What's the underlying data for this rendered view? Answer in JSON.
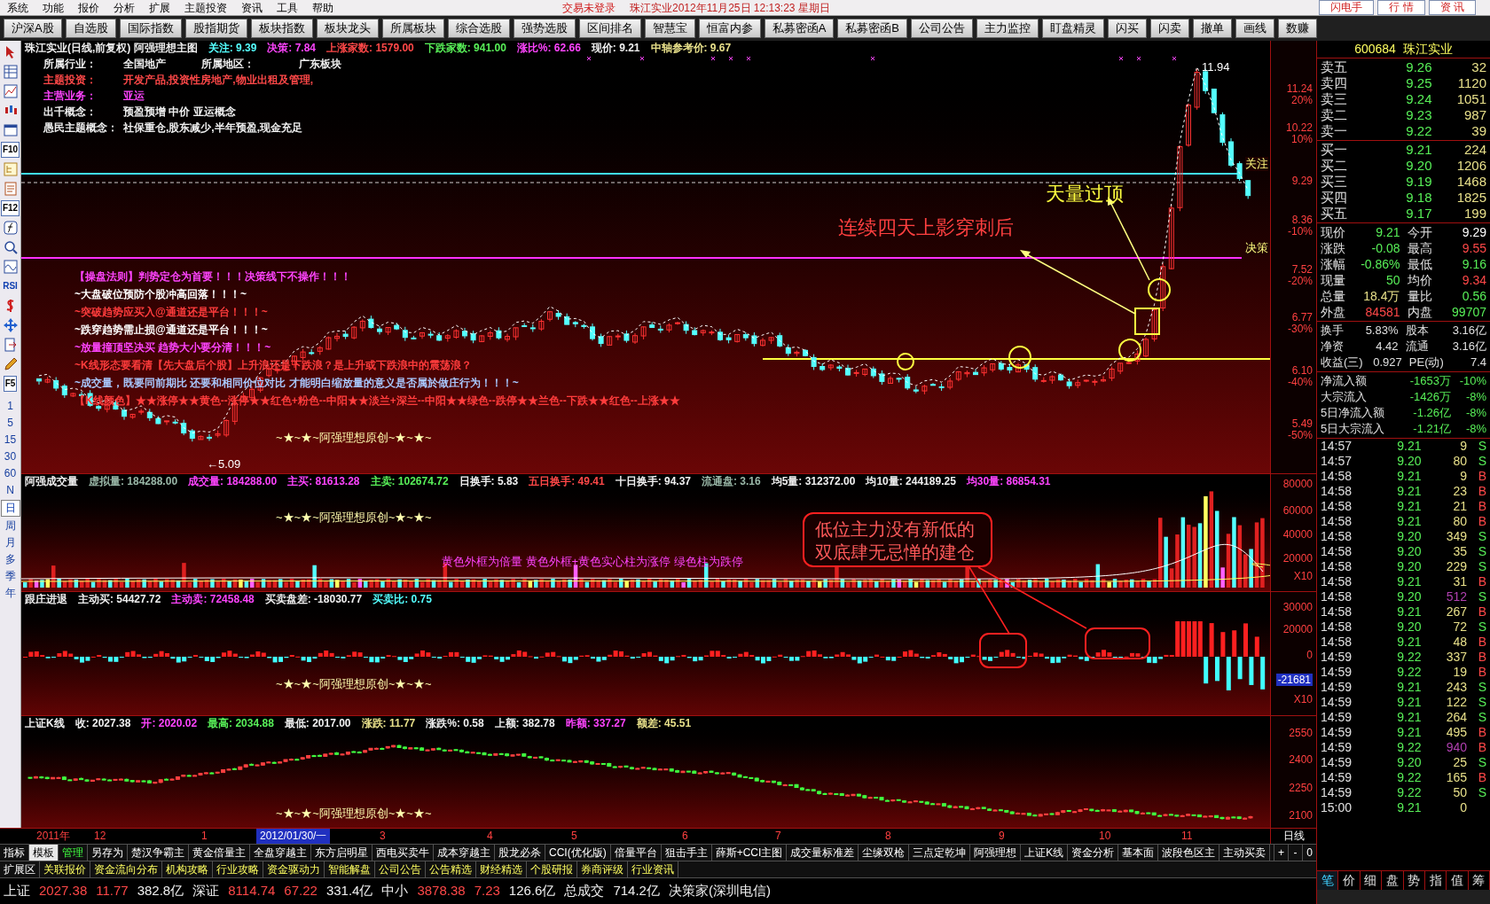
{
  "menu": [
    "系统",
    "功能",
    "报价",
    "分析",
    "扩展",
    "主题投资",
    "资讯",
    "工具",
    "帮助"
  ],
  "status_notice": "交易未登录",
  "title_info": "珠江实业2012年11月25日 12:13:23 星期日",
  "top_buttons": [
    "闪电手",
    "行 情",
    "资 讯"
  ],
  "toolbar": [
    "沪深A股",
    "自选股",
    "国际指数",
    "股指期货",
    "板块指数",
    "板块龙头",
    "所属板块",
    "综合选股",
    "强势选股",
    "区间排名",
    "智慧宝",
    "恒富内参",
    "私募密函A",
    "私募密函B",
    "公司公告",
    "主力监控",
    "盯盘精灵",
    "闪买",
    "闪卖",
    "撤单",
    "画线",
    "数赚"
  ],
  "left_strip": {
    "labels": [
      "F10",
      "F12",
      "RSI",
      "F5"
    ],
    "periods": [
      {
        "label": "1",
        "selected": false
      },
      {
        "label": "5",
        "selected": false
      },
      {
        "label": "15",
        "selected": false
      },
      {
        "label": "30",
        "selected": false
      },
      {
        "label": "60",
        "selected": false
      },
      {
        "label": "N",
        "selected": false
      },
      {
        "label": "日",
        "selected": true
      },
      {
        "label": "周",
        "selected": false
      },
      {
        "label": "月",
        "selected": false
      },
      {
        "label": "多",
        "selected": false
      },
      {
        "label": "季",
        "selected": false
      },
      {
        "label": "年",
        "selected": false
      }
    ]
  },
  "main_chart": {
    "header": [
      {
        "text": "珠江实业(日线,前复权) 阿强理想主图",
        "color": "#f0f0f0"
      },
      {
        "text": "关注: 9.39",
        "color": "#54ffff"
      },
      {
        "text": "决策: 7.84",
        "color": "#ff44ff"
      },
      {
        "text": "上涨家数: 1579.00",
        "color": "#ff4848"
      },
      {
        "text": "下跌家数: 941.00",
        "color": "#58f058"
      },
      {
        "text": "涨比%: 62.66",
        "color": "#ff44ff"
      },
      {
        "text": "现价: 9.21",
        "color": "#f0f0f0"
      },
      {
        "text": "中轴参考价: 9.67",
        "color": "#e8e08a"
      }
    ],
    "info": [
      {
        "label": "所属行业：",
        "value": "全国地产",
        "label2": "所属地区：",
        "value2": "广东板块",
        "color": "#f0f0f0"
      },
      {
        "label": "主题投资：",
        "value": "开发产品,投资性房地产,物业出租及管理,",
        "color": "#ff4848"
      },
      {
        "label": "主营业务：",
        "value": "亚运",
        "color": "#ff44ff"
      },
      {
        "label": "出千概念：",
        "value": "预盈预增 中价 亚运概念",
        "color": "#f0f0f0"
      },
      {
        "label": "愚民主题概念：",
        "value": "社保重仓,股东减少,半年预盈,现金充足",
        "color": "#f0f0f0"
      }
    ],
    "legend": [
      {
        "text": "【操盘法则】判势定仓为首要！！！决策线下不操作！！！",
        "color": "#ff44ff"
      },
      {
        "text": "~大盘破位预防个股冲高回落！！！~",
        "color": "#ffffff"
      },
      {
        "text": "~突破趋势应买入@通道还是平台！！！~",
        "color": "#ff3c3c"
      },
      {
        "text": "~跌穿趋势需止损@通道还是平台！！！~",
        "color": "#ffffff"
      },
      {
        "text": "~放量撞顶坚决买 趋势大小要分清！！！~",
        "color": "#ff44ff"
      },
      {
        "text": "~K线形态要看清【先大盘后个股】上升浪还是下跌浪？是上升或下跌浪中的震荡浪？",
        "color": "#ff3c3c"
      },
      {
        "text": "~成交量，既要同前期比 还要和相同价位对比 才能明白缩放量的意义是否属於做庄行为！！！~",
        "color": "#a8c8ff"
      },
      {
        "text": "【K线颜色】★★涨停★★黄色--涨停★★红色+粉色--中阳★★淡兰+深兰--中阳★★绿色--跌停★★兰色--下跌★★红色--上涨★★",
        "color": "#ff3c3c"
      }
    ],
    "signature": "~★~★~阿强理想原创~★~★~",
    "high_label": "11.94",
    "low_label": "←5.09",
    "line_labels": [
      "关注",
      "决策"
    ],
    "annotations": [
      "天量过顶",
      "连续四天上影穿刺后"
    ],
    "axis": [
      {
        "price": "11.24",
        "pct": "20%"
      },
      {
        "price": "10.22",
        "pct": "10%"
      },
      {
        "price": "9.29"
      },
      {
        "price": "8.36",
        "pct": "-10%"
      },
      {
        "price": "7.52",
        "pct": "-20%"
      },
      {
        "price": "6.77",
        "pct": "-30%"
      },
      {
        "price": "6.10",
        "pct": "-40%"
      },
      {
        "price": "5.49",
        "pct": "-50%"
      }
    ]
  },
  "volume_chart": {
    "header": [
      {
        "text": "阿强成交量",
        "color": "#f0f0f0"
      },
      {
        "text": "虚拟量: 184288.00",
        "color": "#9ab8a8"
      },
      {
        "text": "成交量: 184288.00",
        "color": "#ff44ff"
      },
      {
        "text": "主买: 81613.28",
        "color": "#ff44ff"
      },
      {
        "text": "主卖: 102674.72",
        "color": "#58f058"
      },
      {
        "text": "日换手: 5.83",
        "color": "#f0f0f0"
      },
      {
        "text": "五日换手: 49.41",
        "color": "#ff4848"
      },
      {
        "text": "十日换手: 94.37",
        "color": "#f0f0f0"
      },
      {
        "text": "流通盘: 3.16",
        "color": "#9ab8a8"
      },
      {
        "text": "均5量: 312372.00",
        "color": "#f0f0f0"
      },
      {
        "text": "均10量: 244189.25",
        "color": "#f0f0f0"
      },
      {
        "text": "均30量: 86854.31",
        "color": "#ff44ff"
      }
    ],
    "signature": "~★~★~阿强理想原创~★~★~",
    "note": "黄色外框为倍量  黄色外框+黄色实心柱为涨停  绿色柱为跌停",
    "callout": [
      "低位主力没有新低的",
      "双底肆无忌惮的建仓"
    ],
    "axis": [
      "80000",
      "60000",
      "40000",
      "20000",
      "X10"
    ]
  },
  "flow_chart": {
    "header": [
      {
        "text": "跟庄进退",
        "color": "#f0f0f0"
      },
      {
        "text": "主动买: 54427.72",
        "color": "#f0f0f0"
      },
      {
        "text": "主动卖: 72458.48",
        "color": "#ff44ff"
      },
      {
        "text": "买卖盘差: -18030.77",
        "color": "#f0f0f0"
      },
      {
        "text": "买卖比: 0.75",
        "color": "#54ffff"
      }
    ],
    "signature": "~★~★~阿强理想原创~★~★~",
    "axis": [
      "30000",
      "20000",
      "0",
      "-21681",
      "X10"
    ]
  },
  "index_chart": {
    "header": [
      {
        "text": "上证K线",
        "color": "#f0f0f0"
      },
      {
        "text": "收: 2027.38",
        "color": "#f0f0f0"
      },
      {
        "text": "开: 2020.02",
        "color": "#ff44ff"
      },
      {
        "text": "最高: 2034.88",
        "color": "#58f058"
      },
      {
        "text": "最低: 2017.00",
        "color": "#f0f0f0"
      },
      {
        "text": "涨跌: 11.77",
        "color": "#e8e08a"
      },
      {
        "text": "涨跌%: 0.58",
        "color": "#f0f0f0"
      },
      {
        "text": "上额: 382.78",
        "color": "#f0f0f0"
      },
      {
        "text": "昨额: 337.27",
        "color": "#ff44ff"
      },
      {
        "text": "额差: 45.51",
        "color": "#e8e08a"
      }
    ],
    "signature": "~★~★~阿强理想原创~★~★~",
    "axis": [
      "2550",
      "2400",
      "2250",
      "2100"
    ]
  },
  "date_axis": {
    "labels": [
      {
        "text": "2011年",
        "selected": false
      },
      {
        "text": "12",
        "selected": false
      },
      {
        "text": "1",
        "selected": false
      },
      {
        "text": "2012/01/30/一",
        "selected": true
      },
      {
        "text": "3",
        "selected": false
      },
      {
        "text": "4",
        "selected": false
      },
      {
        "text": "5",
        "selected": false
      },
      {
        "text": "6",
        "selected": false
      },
      {
        "text": "7",
        "selected": false
      },
      {
        "text": "8",
        "selected": false
      },
      {
        "text": "9",
        "selected": false
      },
      {
        "text": "10",
        "selected": false
      },
      {
        "text": "11",
        "selected": false
      }
    ],
    "period": "日线"
  },
  "formula_tabs": [
    {
      "label": "指标",
      "selected": false
    },
    {
      "label": "模板",
      "selected": true
    },
    {
      "label": "管理",
      "selected": false
    },
    {
      "label": "另存为",
      "selected": false
    },
    {
      "label": "楚汉争霸主",
      "selected": false
    },
    {
      "label": "黄金倍量主",
      "selected": false
    },
    {
      "label": "全盘穿越主",
      "selected": false
    },
    {
      "label": "东方启明星",
      "selected": false
    },
    {
      "label": "西电买卖牛",
      "selected": false
    },
    {
      "label": "成本穿越主",
      "selected": false
    },
    {
      "label": "股龙必杀",
      "selected": false
    },
    {
      "label": "CCI(优化版)",
      "selected": false
    },
    {
      "label": "倍量平台",
      "selected": false
    },
    {
      "label": "狙击手主",
      "selected": false
    },
    {
      "label": "薛斯+CCI主图",
      "selected": false
    },
    {
      "label": "成交量标准差",
      "selected": false
    },
    {
      "label": "尘缘双枪",
      "selected": false
    },
    {
      "label": "三点定乾坤",
      "selected": false
    },
    {
      "label": "阿强理想",
      "selected": false
    },
    {
      "label": "上证K线",
      "selected": false
    },
    {
      "label": "资金分析",
      "selected": false
    },
    {
      "label": "基本面",
      "selected": false
    },
    {
      "label": "波段色区主",
      "selected": false
    },
    {
      "label": "主动买卖",
      "selected": false
    }
  ],
  "tab_controls": [
    "+",
    "-",
    "0"
  ],
  "extra_tabs": [
    "扩展区",
    "关联报价",
    "资金流向分布",
    "机构攻略",
    "行业攻略",
    "资金驱动力",
    "智能解盘",
    "公司公告",
    "公告精选",
    "财经精选",
    "个股研报",
    "券商评级",
    "行业资讯"
  ],
  "status_bar": [
    {
      "text": "上证",
      "color": "#f0f0f0"
    },
    {
      "text": "2027.38",
      "color": "#ff4848"
    },
    {
      "text": "11.77",
      "color": "#ff4848"
    },
    {
      "text": "382.8亿",
      "color": "#f0f0f0"
    },
    {
      "text": "深证",
      "color": "#f0f0f0"
    },
    {
      "text": "8114.74",
      "color": "#ff4848"
    },
    {
      "text": "67.22",
      "color": "#ff4848"
    },
    {
      "text": "331.4亿",
      "color": "#f0f0f0"
    },
    {
      "text": "中小",
      "color": "#f0f0f0"
    },
    {
      "text": "3878.38",
      "color": "#ff4848"
    },
    {
      "text": "7.23",
      "color": "#ff4848"
    },
    {
      "text": "126.6亿",
      "color": "#f0f0f0"
    },
    {
      "text": "总成交",
      "color": "#f0f0f0"
    },
    {
      "text": "714.2亿",
      "color": "#f0f0f0"
    },
    {
      "text": "决策家(深圳电信)",
      "color": "#f0f0f0"
    }
  ],
  "quote": {
    "code": "600684",
    "name": "珠江实业",
    "asks": [
      {
        "name": "卖五",
        "price": "9.26",
        "volume": "32"
      },
      {
        "name": "卖四",
        "price": "9.25",
        "volume": "1120"
      },
      {
        "name": "卖三",
        "price": "9.24",
        "volume": "1051"
      },
      {
        "name": "卖二",
        "price": "9.23",
        "volume": "987"
      },
      {
        "name": "卖一",
        "price": "9.22",
        "volume": "39"
      }
    ],
    "bids": [
      {
        "name": "买一",
        "price": "9.21",
        "volume": "224"
      },
      {
        "name": "买二",
        "price": "9.20",
        "volume": "1206"
      },
      {
        "name": "买三",
        "price": "9.19",
        "volume": "1468"
      },
      {
        "name": "买四",
        "price": "9.18",
        "volume": "1825"
      },
      {
        "name": "买五",
        "price": "9.17",
        "volume": "199"
      }
    ],
    "stats": [
      {
        "label": "现价",
        "value": "9.21",
        "color": "#58f058"
      },
      {
        "label": "今开",
        "value": "9.29",
        "color": "#ffffff"
      },
      {
        "label": "涨跌",
        "value": "-0.08",
        "color": "#58f058"
      },
      {
        "label": "最高",
        "value": "9.55",
        "color": "#ff4848"
      },
      {
        "label": "涨幅",
        "value": "-0.86%",
        "color": "#58f058"
      },
      {
        "label": "最低",
        "value": "9.16",
        "color": "#58f058"
      },
      {
        "label": "现量",
        "value": "50",
        "color": "#58f058"
      },
      {
        "label": "均价",
        "value": "9.34",
        "color": "#ff4848"
      },
      {
        "label": "总量",
        "value": "18.4万",
        "color": "#e8e08a"
      },
      {
        "label": "量比",
        "value": "0.56",
        "color": "#58f058"
      },
      {
        "label": "外盘",
        "value": "84581",
        "color": "#ff4848"
      },
      {
        "label": "内盘",
        "value": "99707",
        "color": "#58f058"
      }
    ],
    "fundamentals": [
      {
        "label": "换手",
        "value": "5.83%",
        "label2": "股本",
        "value2": "3.16亿"
      },
      {
        "label": "净资",
        "value": "4.42",
        "label2": "流通",
        "value2": "3.16亿"
      },
      {
        "label": "收益(三)",
        "value": "0.927",
        "label2": "PE(动)",
        "value2": "7.4"
      }
    ],
    "flows": [
      {
        "label": "净流入额",
        "value": "-1653万",
        "pct": "-10%"
      },
      {
        "label": "大宗流入",
        "value": "-1426万",
        "pct": "-8%"
      },
      {
        "label": "5日净流入额",
        "value": "-1.26亿",
        "pct": "-8%"
      },
      {
        "label": "5日大宗流入",
        "value": "-1.21亿",
        "pct": "-8%"
      }
    ],
    "trades": [
      {
        "time": "14:57",
        "price": "9.21",
        "volume": "9",
        "side": "S",
        "large": false
      },
      {
        "time": "14:57",
        "price": "9.20",
        "volume": "80",
        "side": "S",
        "large": false
      },
      {
        "time": "14:58",
        "price": "9.21",
        "volume": "9",
        "side": "B",
        "large": false
      },
      {
        "time": "14:58",
        "price": "9.21",
        "volume": "23",
        "side": "B",
        "large": false
      },
      {
        "time": "14:58",
        "price": "9.21",
        "volume": "21",
        "side": "B",
        "large": false
      },
      {
        "time": "14:58",
        "price": "9.21",
        "volume": "80",
        "side": "B",
        "large": false
      },
      {
        "time": "14:58",
        "price": "9.20",
        "volume": "349",
        "side": "S",
        "large": false
      },
      {
        "time": "14:58",
        "price": "9.20",
        "volume": "35",
        "side": "S",
        "large": false
      },
      {
        "time": "14:58",
        "price": "9.20",
        "volume": "229",
        "side": "S",
        "large": false
      },
      {
        "time": "14:58",
        "price": "9.21",
        "volume": "31",
        "side": "B",
        "large": false
      },
      {
        "time": "14:58",
        "price": "9.20",
        "volume": "512",
        "side": "S",
        "large": true
      },
      {
        "time": "14:58",
        "price": "9.21",
        "volume": "267",
        "side": "B",
        "large": false
      },
      {
        "time": "14:58",
        "price": "9.20",
        "volume": "72",
        "side": "S",
        "large": false
      },
      {
        "time": "14:58",
        "price": "9.21",
        "volume": "48",
        "side": "B",
        "large": false
      },
      {
        "time": "14:59",
        "price": "9.22",
        "volume": "337",
        "side": "B",
        "large": false
      },
      {
        "time": "14:59",
        "price": "9.22",
        "volume": "19",
        "side": "B",
        "large": false
      },
      {
        "time": "14:59",
        "price": "9.21",
        "volume": "243",
        "side": "S",
        "large": false
      },
      {
        "time": "14:59",
        "price": "9.21",
        "volume": "122",
        "side": "S",
        "large": false
      },
      {
        "time": "14:59",
        "price": "9.21",
        "volume": "264",
        "side": "S",
        "large": false
      },
      {
        "time": "14:59",
        "price": "9.21",
        "volume": "495",
        "side": "B",
        "large": false
      },
      {
        "time": "14:59",
        "price": "9.22",
        "volume": "940",
        "side": "B",
        "large": true
      },
      {
        "time": "14:59",
        "price": "9.20",
        "volume": "25",
        "side": "S",
        "large": false
      },
      {
        "time": "14:59",
        "price": "9.22",
        "volume": "165",
        "side": "B",
        "large": false
      },
      {
        "time": "14:59",
        "price": "9.22",
        "volume": "50",
        "side": "S",
        "large": false
      },
      {
        "time": "15:00",
        "price": "9.21",
        "volume": "0",
        "large": false
      }
    ],
    "tabs": [
      {
        "label": "笔",
        "selected": true
      },
      {
        "label": "价",
        "selected": false
      },
      {
        "label": "细",
        "selected": false
      },
      {
        "label": "盘",
        "selected": false
      },
      {
        "label": "势",
        "selected": false
      },
      {
        "label": "指",
        "selected": false
      },
      {
        "label": "值",
        "selected": false
      },
      {
        "label": "筹",
        "selected": false
      }
    ]
  }
}
